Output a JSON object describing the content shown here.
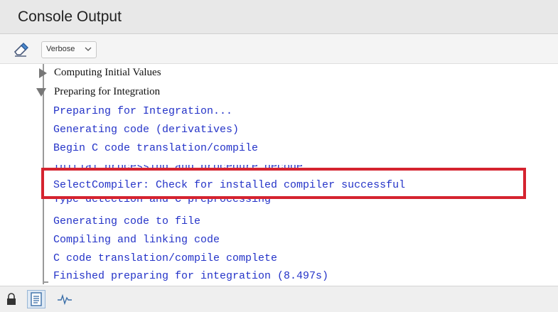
{
  "title": "Console Output",
  "toolbar": {
    "clear_icon": "eraser-icon",
    "verbosity": "Verbose"
  },
  "tree": {
    "collapsed_section": "Computing Initial Values",
    "expanded_section": "Preparing for Integration"
  },
  "log_lines": [
    "Preparing for Integration...",
    "Generating code (derivatives)",
    "Begin C code translation/compile",
    "Initial processing and procedure decode",
    "SelectCompiler: Check for installed compiler successful",
    "Type detection and C preprocessing",
    "Generating code to file",
    "Compiling and linking code",
    "C code translation/compile complete",
    "Finished preparing for integration (8.497s)"
  ],
  "highlight_color": "#d5232f",
  "text_color": "#2433c8",
  "bottom_icons": [
    "lock-icon",
    "document-icon",
    "waveform-icon"
  ]
}
